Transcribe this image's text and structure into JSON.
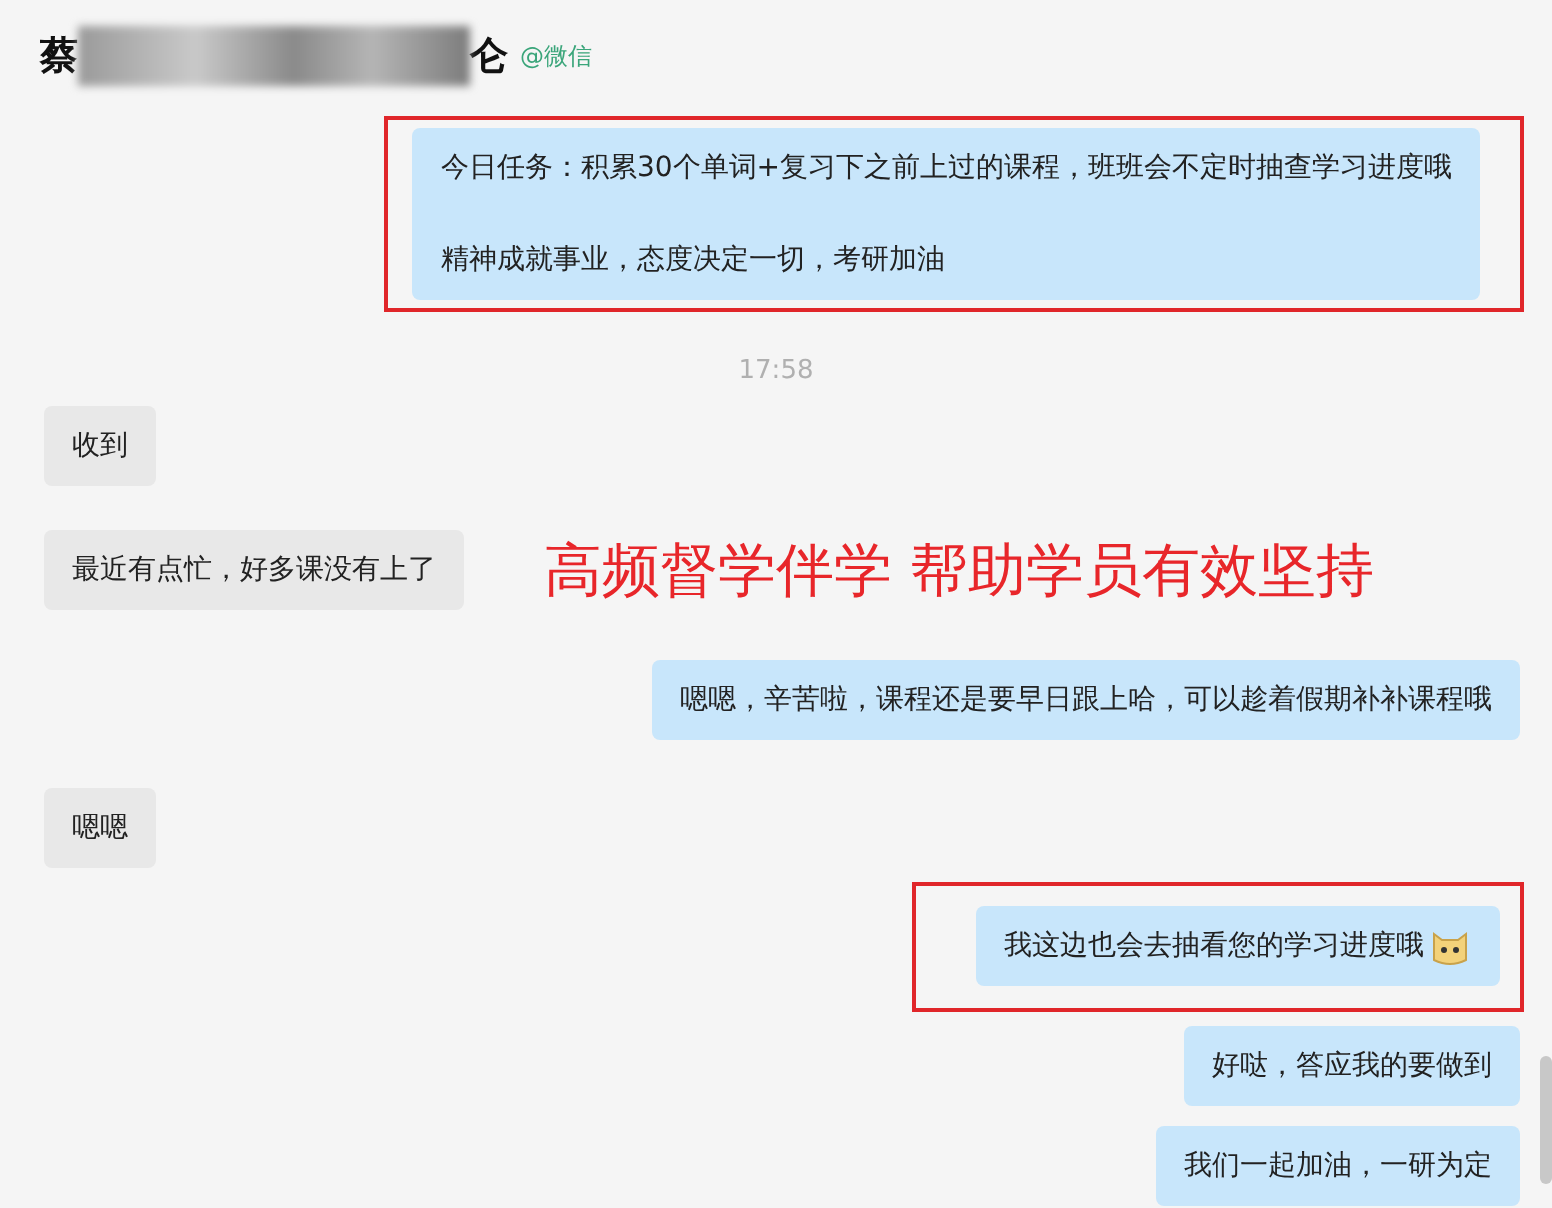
{
  "header": {
    "name_start": "蔡",
    "name_end": "仑",
    "source": "@微信"
  },
  "messages": [
    {
      "kind": "outgoing",
      "lines": [
        "今日任务：积累30个单词+复习下之前上过的课程，班班会不定时抽查学习进度哦",
        "精神成就事业，态度决定一切，考研加油"
      ],
      "highlighted": true,
      "emoji": false
    },
    {
      "kind": "time",
      "lines": [
        "17:58"
      ]
    },
    {
      "kind": "incoming",
      "lines": [
        "收到"
      ],
      "highlighted": false,
      "emoji": false
    },
    {
      "kind": "incoming",
      "lines": [
        "最近有点忙，好多课没有上了"
      ],
      "highlighted": false,
      "emoji": false
    },
    {
      "kind": "outgoing",
      "lines": [
        "嗯嗯，辛苦啦，课程还是要早日跟上哈，可以趁着假期补补课程哦"
      ],
      "highlighted": false,
      "emoji": false
    },
    {
      "kind": "incoming",
      "lines": [
        "嗯嗯"
      ],
      "highlighted": false,
      "emoji": false
    },
    {
      "kind": "outgoing",
      "lines": [
        "我这边也会去抽看您的学习进度哦"
      ],
      "highlighted": true,
      "emoji": true
    },
    {
      "kind": "outgoing",
      "lines": [
        "好哒，答应我的要做到"
      ],
      "highlighted": false,
      "emoji": false
    },
    {
      "kind": "outgoing",
      "lines": [
        "我们一起加油，一研为定"
      ],
      "highlighted": false,
      "emoji": false
    }
  ],
  "annotation": "高频督学伴学 帮助学员有效坚持"
}
